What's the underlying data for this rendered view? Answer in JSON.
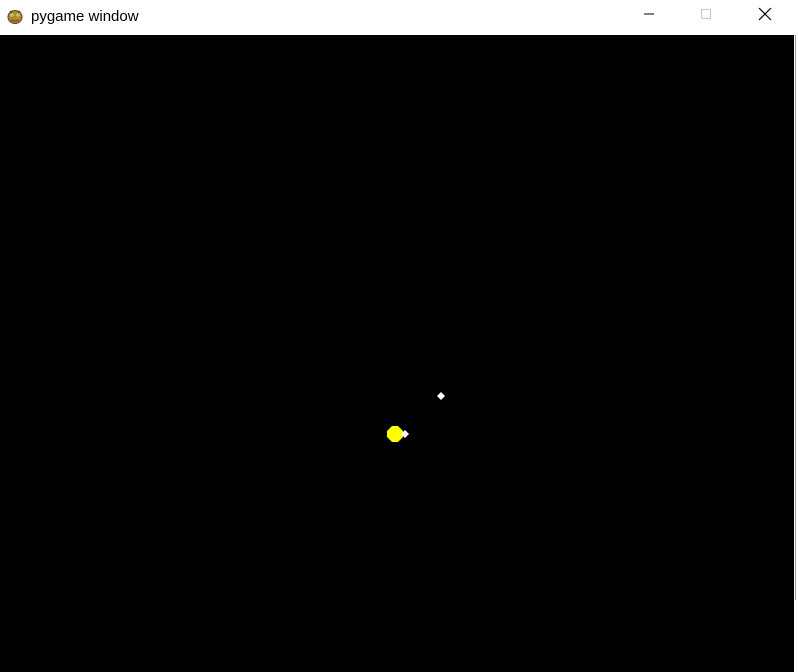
{
  "window": {
    "title": "pygame window",
    "icon": "pygame-snake-icon"
  },
  "titlebar_buttons": {
    "minimize": "minimize-icon",
    "maximize": "maximize-icon",
    "close": "close-icon"
  },
  "game": {
    "background_color": "#000000",
    "sun": {
      "color": "#ffff00",
      "shape": "filled-circle"
    },
    "bodies": [
      {
        "name": "planet-near",
        "color": "#ffffff",
        "shape": "diamond"
      },
      {
        "name": "planet-far",
        "color": "#ffffff",
        "shape": "diamond"
      }
    ]
  }
}
